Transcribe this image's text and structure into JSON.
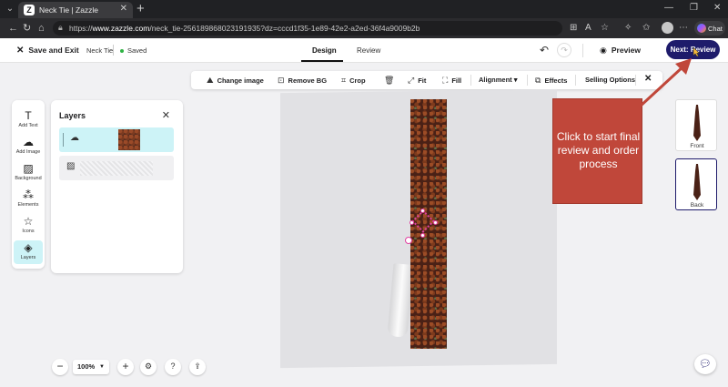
{
  "browser": {
    "tab_title": "Neck Tie | Zazzle",
    "tab_favicon": "Z",
    "url_prefix": "https://",
    "url_host": "www.zazzle.com",
    "url_path": "/neck_tie-256189868023191935?dz=cccd1f35-1e89-42e2-a2ed-36f4a9009b2b",
    "chat_label": "Chat"
  },
  "header": {
    "save_exit": "Save and Exit",
    "product_name": "Neck Tie",
    "saved_status": "Saved",
    "tabs": [
      "Design",
      "Review"
    ],
    "active_tab": "Design",
    "preview": "Preview",
    "next": "Next: Review"
  },
  "toolbar": {
    "change_image": "Change image",
    "remove_bg": "Remove BG",
    "crop": "Crop",
    "fit": "Fit",
    "fill": "Fill",
    "alignment": "Alignment",
    "effects": "Effects",
    "selling_options": "Selling Options"
  },
  "rail": [
    {
      "label": "Add Text",
      "icon": "text-icon"
    },
    {
      "label": "Add Image",
      "icon": "image-upload-icon"
    },
    {
      "label": "Background",
      "icon": "background-icon"
    },
    {
      "label": "Elements",
      "icon": "elements-icon"
    },
    {
      "label": "Icons",
      "icon": "star-icon"
    },
    {
      "label": "Layers",
      "icon": "layers-icon"
    }
  ],
  "layers": {
    "title": "Layers"
  },
  "callout": {
    "text": "Click to start final review and order process"
  },
  "views": [
    {
      "label": "Front"
    },
    {
      "label": "Back"
    }
  ],
  "zoom": {
    "value": "100%"
  },
  "colors": {
    "accent": "#1e1b6b",
    "selection": "#cdf3f7",
    "callout": "#c0473a",
    "saved_dot": "#2fb344"
  }
}
